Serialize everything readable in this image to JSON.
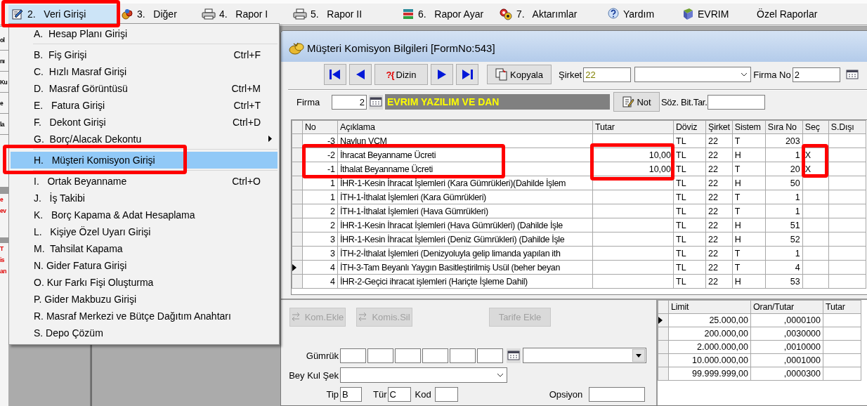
{
  "menubar": [
    {
      "label": "2.   Veri Girişi",
      "selected": true
    },
    {
      "label": "3.   Diğer",
      "selected": false
    },
    {
      "label": "4.   Rapor I",
      "selected": false
    },
    {
      "label": "5.   Rapor II",
      "selected": false
    },
    {
      "label": "6.   Rapor Ayar",
      "selected": false
    },
    {
      "label": "7.   Aktarımlar",
      "selected": false
    },
    {
      "label": "Yardım",
      "selected": false
    },
    {
      "label": "EVRIM",
      "selected": false
    },
    {
      "label": "Özel Raporlar",
      "selected": false
    }
  ],
  "left_panel": {
    "labels": [
      "ol",
      "nı",
      "Ku",
      "e",
      "la"
    ],
    "warning_labels": [
      "e",
      "ev",
      "T",
      "is",
      "an"
    ]
  },
  "dropdown_menu": [
    {
      "kind": "item",
      "label": "A.  Hesap Planı Girişi",
      "selected": false,
      "has_submenu": false
    },
    {
      "kind": "separator"
    },
    {
      "kind": "item",
      "label": "B.  Fiş Girişi",
      "shortcut": "Ctrl+F",
      "selected": false,
      "has_submenu": false
    },
    {
      "kind": "item",
      "label": "C.  Hızlı Masraf Girişi",
      "selected": false,
      "has_submenu": false
    },
    {
      "kind": "item",
      "label": "D.  Masraf Görüntüsü",
      "shortcut": "Ctrl+M",
      "selected": false,
      "has_submenu": false
    },
    {
      "kind": "item",
      "label": "E.   Fatura Girişi",
      "shortcut": "Ctrl+T",
      "selected": false,
      "has_submenu": false
    },
    {
      "kind": "item",
      "label": "F.   Dekont Girişi",
      "shortcut": "Ctrl+D",
      "selected": false,
      "has_submenu": false
    },
    {
      "kind": "item",
      "label": "G.  Borç/Alacak Dekontu",
      "selected": false,
      "has_submenu": true
    },
    {
      "kind": "separator"
    },
    {
      "kind": "item",
      "label": "H.   Müşteri Komisyon Girişi",
      "selected": true,
      "has_submenu": false
    },
    {
      "kind": "separator"
    },
    {
      "kind": "item",
      "label": "I.   Ortak Beyanname",
      "shortcut": "Ctrl+O",
      "selected": false,
      "has_submenu": false
    },
    {
      "kind": "item",
      "label": "J.   İş Takibi",
      "selected": false,
      "has_submenu": false
    },
    {
      "kind": "item",
      "label": "K.   Borç Kapama & Adat Hesaplama",
      "selected": false,
      "has_submenu": false
    },
    {
      "kind": "item",
      "label": "L.   Kişiye Özel Uyarı Girişi",
      "selected": false,
      "has_submenu": false
    },
    {
      "kind": "item",
      "label": "M.  Tahsilat Kapama",
      "selected": false,
      "has_submenu": false
    },
    {
      "kind": "item",
      "label": "N. Gider Fatura Girişi",
      "selected": false,
      "has_submenu": false
    },
    {
      "kind": "item",
      "label": "O. Kur Farkı Fişi Oluşturma",
      "selected": false,
      "has_submenu": false
    },
    {
      "kind": "item",
      "label": "P. Gider Makbuzu Girişi",
      "selected": false,
      "has_submenu": false
    },
    {
      "kind": "item",
      "label": "R. Masraf Merkezi ve Bütçe Dağıtım Anahtarı",
      "selected": false,
      "has_submenu": false
    },
    {
      "kind": "item",
      "label": "S. Depo Çözüm",
      "selected": false,
      "has_submenu": false
    }
  ],
  "form": {
    "title": "Müşteri Komisyon Bilgileri [FormNo:543]",
    "toolbar": {
      "index_icon_text": "?{",
      "index_label": "Dizin",
      "copy_label": "Kopyala",
      "company_label": "Şirket",
      "company_value": "22",
      "firm_no_label": "Firma No",
      "firm_no_value": "2"
    },
    "firm_row": {
      "label": "Firma",
      "value": "2",
      "name": "EVRIM YAZILIM VE DAN",
      "note_label": "Not",
      "contract_end_label": "Söz. Bit.Tar."
    },
    "table": {
      "columns": [
        "No",
        "Açıklama",
        "Tutar",
        "Döviz",
        "Şirket",
        "Sistem",
        "Sıra No",
        "Seç",
        "S.Dışı"
      ],
      "rows": [
        {
          "selected": false,
          "cells": [
            "-3",
            "Navlun VCM",
            "",
            "TL",
            "22",
            "T",
            "203",
            "",
            ""
          ]
        },
        {
          "selected": false,
          "cells": [
            "-2",
            "İhracat Beyanname Ücreti",
            "10,00",
            "TL",
            "22",
            "H",
            "1",
            "X",
            ""
          ]
        },
        {
          "selected": false,
          "cells": [
            "-1",
            "İthalat Beyanname Ücreti",
            "10,00",
            "TL",
            "22",
            "T",
            "20",
            "X",
            ""
          ]
        },
        {
          "selected": false,
          "cells": [
            "1",
            "İHR-1-Kesin İhracat İşlemleri (Kara Gümrükleri)(Dahilde İşlem",
            "",
            "TL",
            "22",
            "H",
            "50",
            "",
            ""
          ]
        },
        {
          "selected": false,
          "cells": [
            "1",
            "İTH-1-İthalat İşlemleri  (Kara Gümrükleri)",
            "",
            "TL",
            "22",
            "T",
            "1",
            "",
            ""
          ]
        },
        {
          "selected": false,
          "cells": [
            "2",
            "İTH-1-İthalat İşlemleri  (Hava Gümrükleri)",
            "",
            "TL",
            "22",
            "T",
            "1",
            "",
            ""
          ]
        },
        {
          "selected": false,
          "cells": [
            "2",
            "İHR-1-Kesin İhracat İşlemleri (Hava Gümrükleri) (Dahilde İşle",
            "",
            "TL",
            "22",
            "H",
            "51",
            "",
            ""
          ]
        },
        {
          "selected": false,
          "cells": [
            "3",
            "İHR-1-Kesin İhracat İşlemleri (Deniz Gümrükleri) (Dahilde İşle",
            "",
            "TL",
            "22",
            "H",
            "52",
            "",
            ""
          ]
        },
        {
          "selected": false,
          "cells": [
            "3",
            "İTH-2-İthalat İşlemleri (Denizyoluyla gelip limanda yapılan ith",
            "",
            "TL",
            "22",
            "T",
            "1",
            "",
            ""
          ]
        },
        {
          "selected": true,
          "cells": [
            "4",
            "İTH-3-Tam Beyanlı Yaygın Basitleştirilmiş Usül (beher beyan",
            "",
            "TL",
            "22",
            "T",
            "4",
            "",
            ""
          ]
        },
        {
          "selected": false,
          "cells": [
            "4",
            "İHR-2-Geçici ihracat işlemleri (Hariçte İşleme Dahil)",
            "",
            "TL",
            "22",
            "H",
            "53",
            "",
            ""
          ]
        }
      ]
    },
    "actions": [
      {
        "label": "Kom.Ekle",
        "disabled": true
      },
      {
        "label": "Komis.Sil",
        "disabled": true
      },
      {
        "label": "Tarife Ekle",
        "disabled": true
      }
    ],
    "fields": {
      "customs_label": "Gümrük",
      "declaration_label": "Bey Kul Şek",
      "type_label": "Tip",
      "type_value": "B",
      "kind_label": "Tür",
      "kind_value": "C",
      "code_label": "Kod",
      "option_label": "Opsiyon"
    },
    "limits_table": {
      "columns": [
        "Limit",
        "Oran/Tutar",
        "Tutar"
      ],
      "rows": [
        {
          "selected": true,
          "cells": [
            "25.000,00",
            ",0000100",
            ""
          ]
        },
        {
          "selected": false,
          "cells": [
            "200.000,00",
            ",0030000",
            ""
          ]
        },
        {
          "selected": false,
          "cells": [
            "2.000.000,00",
            ",0010000",
            ""
          ]
        },
        {
          "selected": false,
          "cells": [
            "10.000.000,00",
            ",0001000",
            ""
          ]
        },
        {
          "selected": false,
          "cells": [
            "99.999.999,00",
            ",0000300",
            ""
          ]
        }
      ]
    }
  }
}
